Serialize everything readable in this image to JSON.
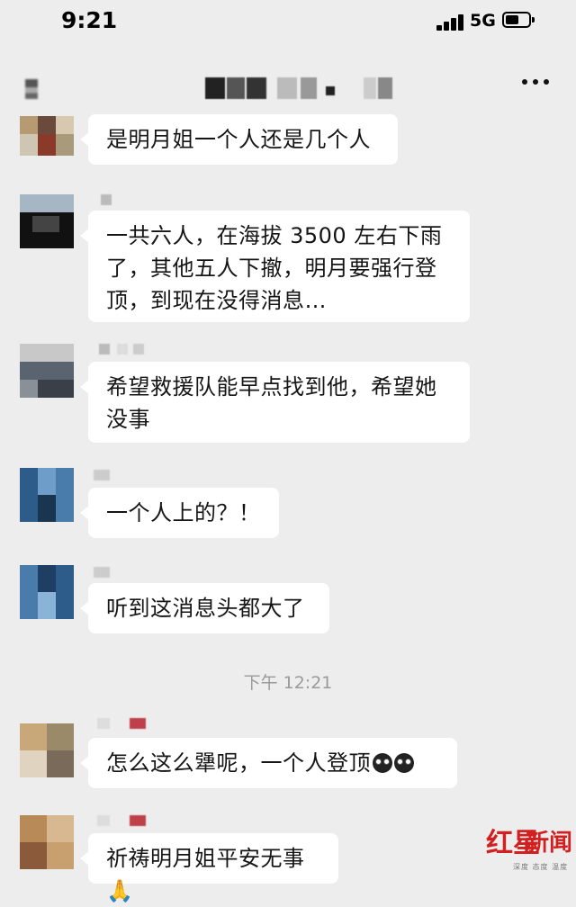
{
  "status_bar": {
    "time": "9:21",
    "network": "5G"
  },
  "title_bar": {
    "more_label": "···"
  },
  "messages": [
    {
      "text": "是明月姐一个人还是几个人"
    },
    {
      "text": "一共六人，在海拔 3500 左右下雨了，其他五人下撤，明月要强行登顶，到现在没得消息…"
    },
    {
      "text": "希望救援队能早点找到他，希望她没事"
    },
    {
      "text": "一个人上的？！"
    },
    {
      "text": "听到这消息头都大了"
    },
    {
      "text": "怎么这么犟呢，一个人登顶"
    },
    {
      "text": "祈祷明月姐平安无事"
    }
  ],
  "time_divider": "下午 12:21",
  "emoji": {
    "pray": "🙏"
  },
  "watermark": {
    "mark": "红星",
    "name": "新闻",
    "sub": "深度 态度 温度"
  },
  "colors": {
    "background": "#ededed",
    "bubble": "#ffffff",
    "watermark": "#d21f1f"
  }
}
